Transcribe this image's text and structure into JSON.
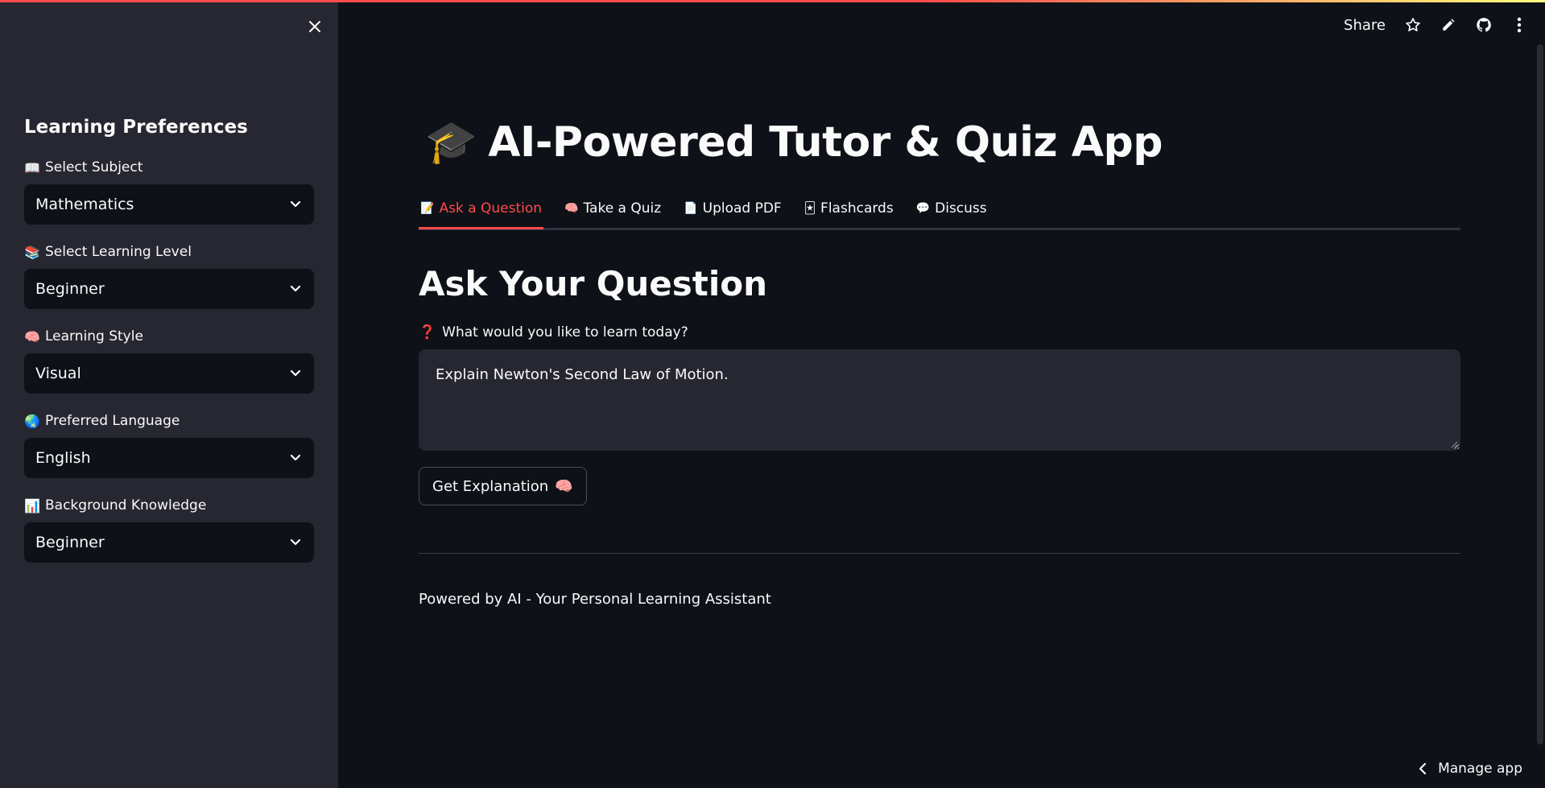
{
  "header": {
    "share_label": "Share",
    "icons": [
      "star-icon",
      "pencil-icon",
      "github-icon",
      "more-vertical-icon"
    ]
  },
  "sidebar": {
    "title": "Learning Preferences",
    "fields": [
      {
        "icon": "📖",
        "label": "Select Subject",
        "value": "Mathematics"
      },
      {
        "icon": "📚",
        "label": "Select Learning Level",
        "value": "Beginner"
      },
      {
        "icon": "🧠",
        "label": "Learning Style",
        "value": "Visual"
      },
      {
        "icon": "🌏",
        "label": "Preferred Language",
        "value": "English"
      },
      {
        "icon": "📊",
        "label": "Background Knowledge",
        "value": "Beginner"
      }
    ]
  },
  "main": {
    "app_title_icon": "🎓",
    "app_title": "AI-Powered Tutor & Quiz App",
    "tabs": [
      {
        "icon": "📝",
        "label": "Ask a Question",
        "active": true
      },
      {
        "icon": "🧠",
        "label": "Take a Quiz",
        "active": false
      },
      {
        "icon": "📄",
        "label": "Upload PDF",
        "active": false
      },
      {
        "icon": "🃏",
        "label": "Flashcards",
        "active": false
      },
      {
        "icon": "💬",
        "label": "Discuss",
        "active": false
      }
    ],
    "section_title": "Ask Your Question",
    "question_label_icon": "❓",
    "question_label": "What would you like to learn today?",
    "question_value": "Explain Newton's Second Law of Motion.",
    "button_label": "Get Explanation",
    "button_icon": "🧠",
    "footer": "Powered by AI - Your Personal Learning Assistant",
    "manage_app": "Manage app"
  },
  "colors": {
    "accent": "#ff4b4b",
    "background": "#0e1117",
    "sidebar": "#262730"
  }
}
